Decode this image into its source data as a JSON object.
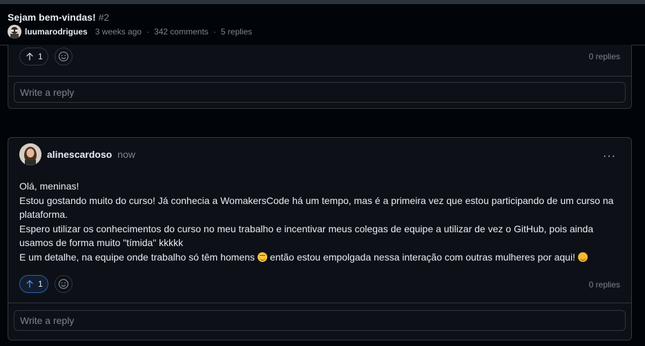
{
  "discussion": {
    "title": "Sejam bem-vindas!",
    "number": "#2",
    "author": "luumarodrigues",
    "time": "3 weeks ago",
    "comments": "342 comments",
    "replies_total": "5 replies",
    "separator": "·"
  },
  "comment_prev": {
    "upvotes": "1",
    "replies": "0 replies",
    "reply_placeholder": "Write a reply"
  },
  "comment": {
    "author": "alinescardoso",
    "time": "now",
    "more_label": "···",
    "lines": [
      "Olá, meninas!",
      "Estou gostando muito do curso! Já conhecia a WomakersCode há um tempo, mas é a primeira vez que estou participando de um curso na plataforma.",
      "Espero utilizar os conhecimentos do curso no meu trabalho e incentivar meus colegas de equipe a utilizar de vez o GitHub, pois ainda usamos de forma muito \"tímida\" kkkkk"
    ],
    "last_line_part1": "E um detalhe, na equipe onde trabalho só têm homens",
    "last_line_part2": "então estou empolgada nessa interação com outras mulheres por aqui!",
    "emoji_1": "grin-emoji",
    "emoji_2": "smile-emoji",
    "upvotes": "1",
    "replies": "0 replies",
    "reply_placeholder": "Write a reply"
  },
  "colors": {
    "background": "#010409",
    "card": "#0d1117",
    "border": "#30363d",
    "muted": "#7d8590",
    "active_vote": "#2f5fa8"
  }
}
